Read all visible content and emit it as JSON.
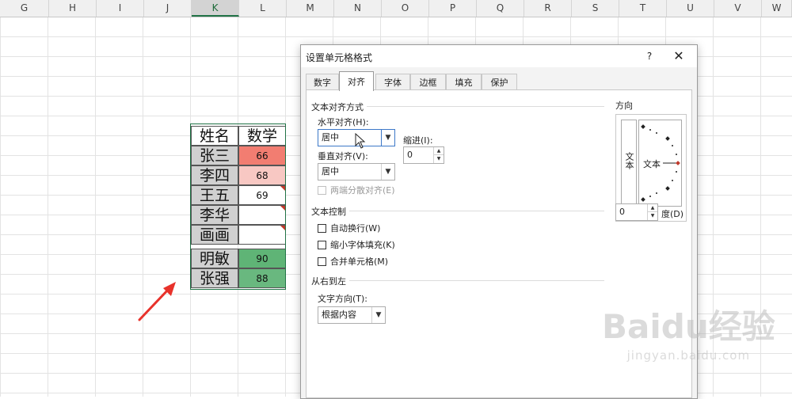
{
  "sheet": {
    "columns": [
      "G",
      "H",
      "I",
      "J",
      "K",
      "L",
      "M",
      "N",
      "O",
      "P",
      "Q",
      "R",
      "S",
      "T",
      "U",
      "V",
      "W"
    ],
    "active_column": "K",
    "header_row": {
      "name": "姓名",
      "score": "数学"
    },
    "rows": [
      {
        "name": "张三",
        "score": "66",
        "fill": "#f27d71",
        "error_flag": false
      },
      {
        "name": "李四",
        "score": "68",
        "fill": "#f8c8c3",
        "error_flag": false
      },
      {
        "name": "王五",
        "score": "69",
        "fill": "#ffffff",
        "error_flag": true
      },
      {
        "name": "李华",
        "score": "",
        "fill": "#ffffff",
        "error_flag": true
      },
      {
        "name": "画画",
        "score": "",
        "fill": "#ffffff",
        "error_flag": true
      },
      {
        "name": "明敏",
        "score": "90",
        "fill": "#5fb476",
        "error_flag": false
      },
      {
        "name": "张强",
        "score": "88",
        "fill": "#69b87f",
        "error_flag": false
      }
    ],
    "arrow_color": "#e8322b"
  },
  "dialog": {
    "title": "设置单元格格式",
    "help_label": "?",
    "close_label": "✕",
    "tabs": [
      {
        "label": "数字",
        "active": false
      },
      {
        "label": "对齐",
        "active": true
      },
      {
        "label": "字体",
        "active": false
      },
      {
        "label": "边框",
        "active": false
      },
      {
        "label": "填充",
        "active": false
      },
      {
        "label": "保护",
        "active": false
      }
    ],
    "alignment": {
      "section_label": "文本对齐方式",
      "horizontal_label": "水平对齐(H):",
      "horizontal_value": "居中",
      "indent_label": "缩进(I):",
      "indent_value": "0",
      "vertical_label": "垂直对齐(V):",
      "vertical_value": "居中",
      "distributed_label": "两端分散对齐(E)"
    },
    "text_control": {
      "section_label": "文本控制",
      "wrap_label": "自动换行(W)",
      "shrink_label": "缩小字体填充(K)",
      "merge_label": "合并单元格(M)"
    },
    "rtl": {
      "section_label": "从右到左",
      "direction_label": "文字方向(T):",
      "direction_value": "根据内容"
    },
    "orientation": {
      "section_label": "方向",
      "vertical_text": "文本",
      "dial_text": "文本",
      "degrees_value": "0",
      "degrees_label": "度(D)"
    }
  },
  "watermark": {
    "logo": "Baidu经验",
    "url": "jingyan.baidu.com"
  }
}
